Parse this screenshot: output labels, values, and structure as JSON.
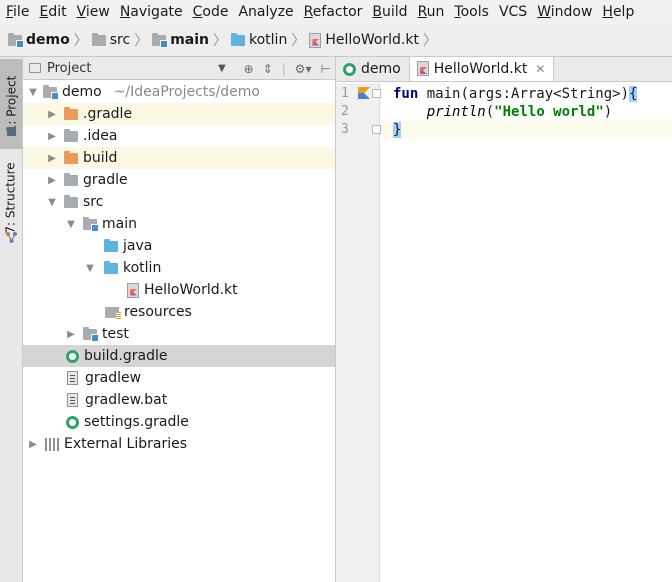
{
  "menu": [
    {
      "label": "File",
      "mnemonic": "F",
      "rest": "ile"
    },
    {
      "label": "Edit",
      "mnemonic": "E",
      "rest": "dit"
    },
    {
      "label": "View",
      "mnemonic": "V",
      "rest": "iew"
    },
    {
      "label": "Navigate",
      "mnemonic": "N",
      "rest": "avigate"
    },
    {
      "label": "Code",
      "mnemonic": "C",
      "rest": "ode"
    },
    {
      "label": "Analyze",
      "mnemonic": "",
      "rest": "Analyze"
    },
    {
      "label": "Refactor",
      "mnemonic": "R",
      "rest": "efactor"
    },
    {
      "label": "Build",
      "mnemonic": "B",
      "rest": "uild"
    },
    {
      "label": "Run",
      "mnemonic": "R",
      "rest": "un"
    },
    {
      "label": "Tools",
      "mnemonic": "T",
      "rest": "ools"
    },
    {
      "label": "VCS",
      "mnemonic": "",
      "rest": "VCS"
    },
    {
      "label": "Window",
      "mnemonic": "W",
      "rest": "indow"
    },
    {
      "label": "Help",
      "mnemonic": "H",
      "rest": "elp"
    }
  ],
  "breadcrumb": [
    "demo",
    "src",
    "main",
    "kotlin",
    "HelloWorld.kt"
  ],
  "left_stripe": {
    "project_tab": "1: Project",
    "structure_tab": "7: Structure"
  },
  "project_panel": {
    "title": "Project",
    "tree": [
      {
        "label": "demo",
        "hint": "~/IdeaProjects/demo"
      },
      {
        "label": ".gradle"
      },
      {
        "label": ".idea"
      },
      {
        "label": "build"
      },
      {
        "label": "gradle"
      },
      {
        "label": "src"
      },
      {
        "label": "main"
      },
      {
        "label": "java"
      },
      {
        "label": "kotlin"
      },
      {
        "label": "HelloWorld.kt"
      },
      {
        "label": "resources"
      },
      {
        "label": "test"
      },
      {
        "label": "build.gradle"
      },
      {
        "label": "gradlew"
      },
      {
        "label": "gradlew.bat"
      },
      {
        "label": "settings.gradle"
      },
      {
        "label": "External Libraries"
      }
    ]
  },
  "editor": {
    "tabs": [
      {
        "label": "demo"
      },
      {
        "label": "HelloWorld.kt"
      }
    ],
    "line_numbers": [
      "1",
      "2",
      "3"
    ],
    "code": {
      "l1_kw": "fun",
      "l1_rest": " main(args:Array<String>)",
      "l1_brace": "{",
      "l2_indent": "    ",
      "l2_fn": "println",
      "l2_open": "(",
      "l2_str": "\"Hello world\"",
      "l2_close": ")",
      "l3_brace": "}"
    }
  },
  "colors": {
    "keyword": "#000080",
    "string": "#008000",
    "excluded_bg": "#fbf8e3",
    "selected_bg": "#d5d5d5"
  }
}
